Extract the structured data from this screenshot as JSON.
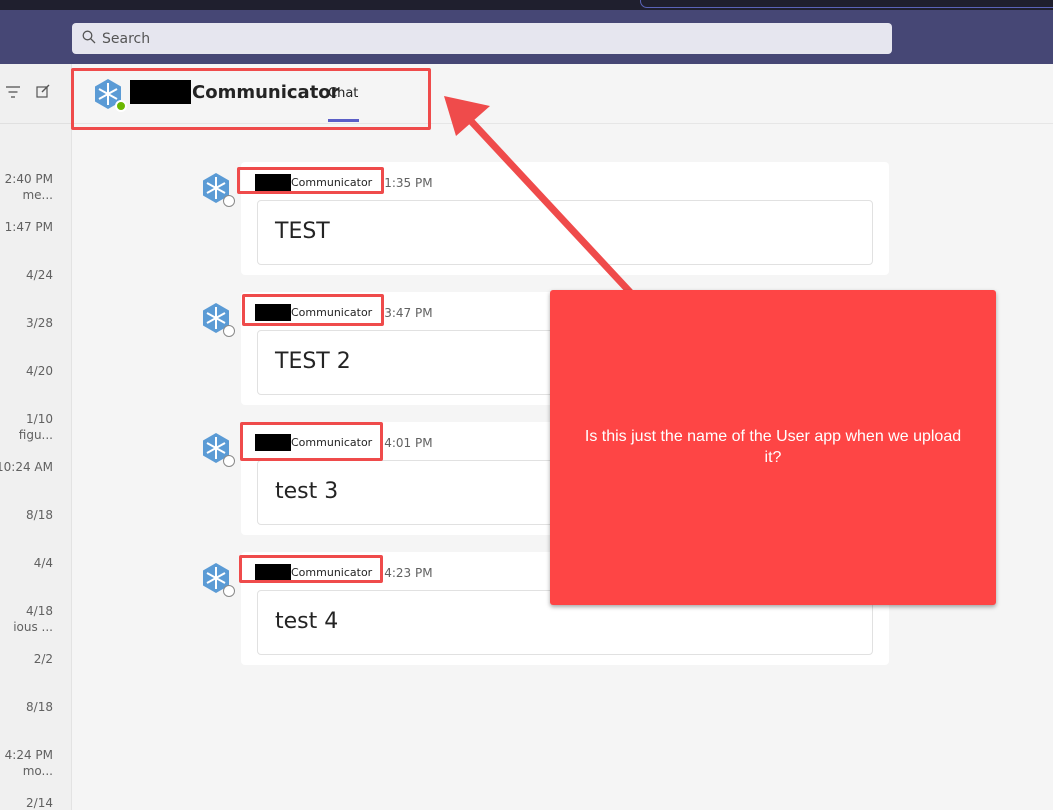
{
  "search": {
    "placeholder": "Search"
  },
  "sidebar": {
    "conversations": [
      {
        "time": "2:40 PM",
        "preview": "me..."
      },
      {
        "time": "1:47 PM",
        "preview": ""
      },
      {
        "time": "4/24",
        "preview": ""
      },
      {
        "time": "3/28",
        "preview": ""
      },
      {
        "time": "4/20",
        "preview": ""
      },
      {
        "time": "1/10",
        "preview": "figu..."
      },
      {
        "time": "10:24 AM",
        "preview": ""
      },
      {
        "time": "8/18",
        "preview": ""
      },
      {
        "time": "4/4",
        "preview": ""
      },
      {
        "time": "4/18",
        "preview": "ious ..."
      },
      {
        "time": "2/2",
        "preview": ""
      },
      {
        "time": "8/18",
        "preview": ""
      },
      {
        "time": "4:24 PM",
        "preview": "mo..."
      },
      {
        "time": "2/14",
        "preview": ""
      }
    ]
  },
  "header": {
    "name": "Communicator",
    "tab": "Chat",
    "status": "available"
  },
  "messages": [
    {
      "sender": "Communicator",
      "time": "1:35 PM",
      "text": "TEST"
    },
    {
      "sender": "Communicator",
      "time": "3:47 PM",
      "text": "TEST 2"
    },
    {
      "sender": "Communicator",
      "time": "4:01 PM",
      "text": "test 3"
    },
    {
      "sender": "Communicator",
      "time": "4:23 PM",
      "text": "test 4"
    }
  ],
  "annotation": {
    "callout_text": "Is this just the name of the User app when we upload it?",
    "color": "#fe4545"
  },
  "colors": {
    "topbar": "#464775",
    "accent": "#5b5fc7",
    "avatar": "#5b9bd5",
    "annotation": "#ef4b4b"
  }
}
